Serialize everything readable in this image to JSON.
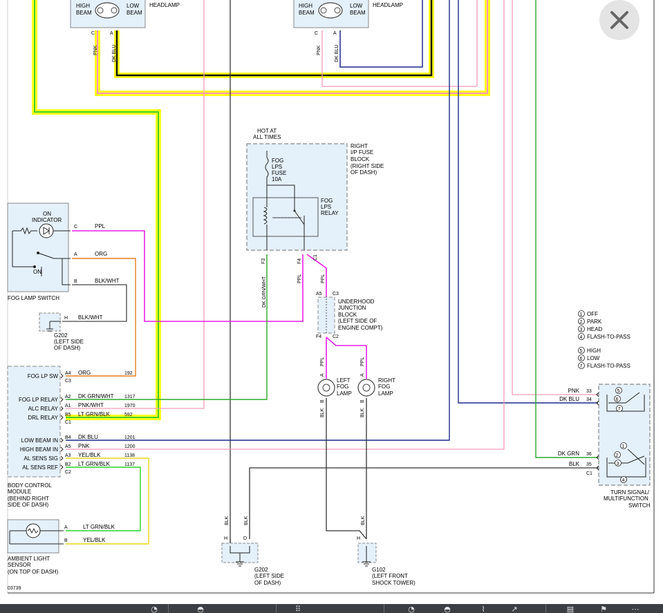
{
  "viewer": {
    "close_symbol": "✕",
    "close_icon": "close-icon",
    "toolbar_icons": [
      "zoom-in-icon",
      "zoom-out-icon",
      "grid-icon",
      "search-icon",
      "search-icon",
      "tag-icon",
      "share-icon",
      "grid-icon",
      "flag-icon",
      "more-icon"
    ]
  },
  "diagram": {
    "headlamps": {
      "left": {
        "high": "HIGH",
        "beam": "BEAM",
        "low": "LOW",
        "beam2": "BEAM",
        "name": "HEADLAMP",
        "pin_c": "C",
        "pin_a": "A",
        "wire1": "PNK",
        "wire2": "DK BLU"
      },
      "right": {
        "high": "HIGH",
        "beam": "BEAM",
        "low": "LOW",
        "beam2": "BEAM",
        "name": "HEADLAMP",
        "pin_c": "C",
        "pin_a": "A",
        "wire1": "PNK",
        "wire2": "DK BLU"
      }
    },
    "fuse_block": {
      "hot1": "HOT AT",
      "hot2": "ALL TIMES",
      "title": [
        "RIGHT",
        "I/P FUSE",
        "BLOCK",
        "(RIGHT SIDE",
        "OF DASH)"
      ],
      "fuse": [
        "FOG",
        "LPS",
        "FUSE",
        "10A"
      ],
      "relay": [
        "FOG",
        "LPS",
        "RELAY"
      ],
      "pins": {
        "f3": "F3",
        "f4": "F4",
        "c1": "C1"
      },
      "wires": {
        "dkgrnwht": "DK GRN/WHT",
        "ppl": "PPL",
        "ppl2": "PPL"
      }
    },
    "underhood": {
      "pins": {
        "a5": "A5",
        "c3": "C3",
        "f4": "F4",
        "c2": "C2"
      },
      "title": [
        "UNDERHOOD",
        "JUNCTION",
        "BLOCK",
        "(LEFT SIDE OF",
        "ENGINE COMPT)"
      ]
    },
    "fog_lamps": {
      "left": {
        "l1": "LEFT",
        "l2": "FOG",
        "l3": "LAMP",
        "pin_a": "A",
        "pin_b": "B",
        "wire_a": "PPL",
        "wire_b": "BLK"
      },
      "right": {
        "l1": "RIGHT",
        "l2": "FOG",
        "l3": "LAMP",
        "pin_a": "A",
        "pin_b": "B",
        "wire_a": "PPL",
        "wire_b": "BLK"
      }
    },
    "fog_switch": {
      "on_indicator": [
        "ON",
        "INDICATOR"
      ],
      "on": "ON",
      "name": "FOG LAMP SWITCH",
      "pins": {
        "c": "C",
        "a": "A",
        "b": "B",
        "h": "H"
      },
      "wires": {
        "c": "PPL",
        "a": "ORG",
        "b": "BLK/WHT",
        "h": "BLK/WHT"
      },
      "ground": [
        "G202",
        "(LEFT SIDE",
        "OF DASH)"
      ]
    },
    "bcm": {
      "rows": [
        {
          "label": "FOG LP SW",
          "pin": "A4",
          "conn": "C3",
          "wire": "ORG",
          "circuit": "192"
        },
        {
          "label": "FOG LP RELAY",
          "pin": "A2",
          "conn": "",
          "wire": "DK GRN/WHT",
          "circuit": "1317"
        },
        {
          "label": "ALC RELAY",
          "pin": "A1",
          "conn": "",
          "wire": "PNK/WHT",
          "circuit": "1970"
        },
        {
          "label": "DRL RELAY",
          "pin": "B5",
          "conn": "C1",
          "wire": "LT GRN/BLK",
          "circuit": "592"
        },
        {
          "label": "LOW BEAM IN",
          "pin": "B4",
          "conn": "",
          "wire": "DK BLU",
          "circuit": "1201"
        },
        {
          "label": "HIGH BEAM IN",
          "pin": "A5",
          "conn": "",
          "wire": "PNK",
          "circuit": "1200"
        },
        {
          "label": "AL SENS SIG",
          "pin": "A3",
          "conn": "",
          "wire": "YEL/BLK",
          "circuit": "1138"
        },
        {
          "label": "AL SENS REF",
          "pin": "B2",
          "conn": "C2",
          "wire": "LT GRN/BLK",
          "circuit": "1137"
        }
      ],
      "name": [
        "BODY CONTROL",
        "MODULE",
        "(BEHIND RIGHT",
        "SIDE OF DASH)"
      ]
    },
    "ambient": {
      "pins": {
        "a": "A",
        "b": "B"
      },
      "wires": {
        "a": "LT GRN/BLK",
        "b": "YEL/BLK"
      },
      "name": [
        "AMBIENT LIGHT",
        "SENSOR",
        "(ON TOP OF DASH)"
      ],
      "code": "03739"
    },
    "legend": [
      {
        "n": "1",
        "text": "OFF"
      },
      {
        "n": "2",
        "text": "PARK"
      },
      {
        "n": "3",
        "text": "HEAD"
      },
      {
        "n": "4",
        "text": "FLASH-TO-PASS"
      },
      {
        "n": "5",
        "text": "HIGH"
      },
      {
        "n": "6",
        "text": "LOW"
      },
      {
        "n": "7",
        "text": "FLASH-TO-PASS"
      }
    ],
    "turn_switch": {
      "rows": [
        {
          "wire": "PNK",
          "pin": "33"
        },
        {
          "wire": "DK BLU",
          "pin": "34"
        },
        {
          "wire": "DK GRN",
          "pin": "36"
        },
        {
          "wire": "BLK",
          "pin": "35"
        }
      ],
      "conn": "C1",
      "name": [
        "TURN SIGNAL/",
        "MULTIFUNCTION",
        "SWITCH"
      ]
    },
    "grounds": {
      "g202": {
        "wire1": "BLK",
        "wire2": "BLK",
        "pin_h": "H",
        "pin_d": "D",
        "name": [
          "G202",
          "(LEFT SIDE",
          "OF DASH)"
        ]
      },
      "g102": {
        "wire": "BLK",
        "pin_h": "H",
        "name": [
          "G102",
          "(LEFT FRONT",
          "SHOCK TOWER)"
        ]
      }
    }
  }
}
